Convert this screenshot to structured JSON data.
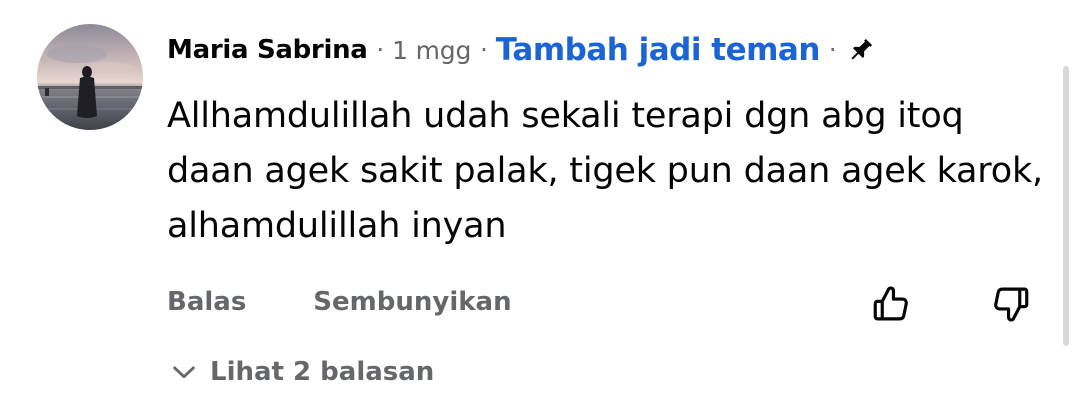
{
  "comment": {
    "author": "Maria Sabrina",
    "separator": "·",
    "time": "1 mgg",
    "add_friend_label": "Tambah jadi teman",
    "pin_icon": "pin-icon",
    "text": "Allhamdulillah udah sekali terapi dgn abg itoq daan agek sakit palak, tigek pun daan agek karok, alhamdulillah inyan",
    "actions": {
      "reply_label": "Balas",
      "hide_label": "Sembunyikan",
      "upvote_icon": "thumbs-up-icon",
      "downvote_icon": "thumbs-down-icon"
    },
    "replies": {
      "label": "Lihat 2 balasan",
      "icon": "chevron-down-icon"
    }
  },
  "colors": {
    "link_blue": "#1b64d6",
    "secondary_text": "#65676b",
    "primary_text": "#050505",
    "background": "#ffffff"
  }
}
